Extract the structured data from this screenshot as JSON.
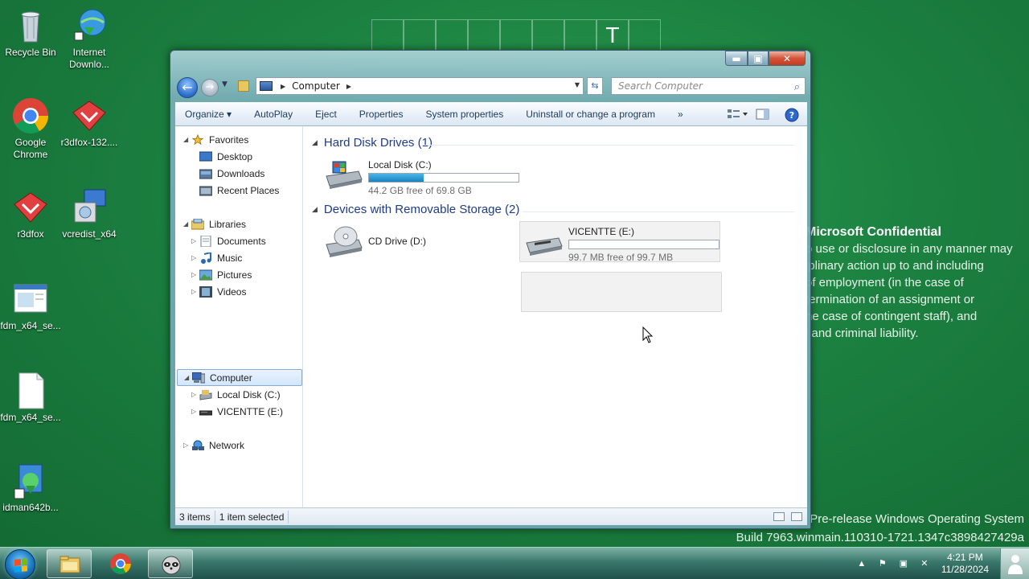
{
  "desktop": {
    "grid_letter": "T",
    "icons": [
      {
        "label": "Recycle Bin"
      },
      {
        "label": "Internet Downlo..."
      },
      {
        "label": "Google Chrome"
      },
      {
        "label": "r3dfox-132...."
      },
      {
        "label": "r3dfox"
      },
      {
        "label": "vcredist_x64"
      },
      {
        "label": "fdm_x64_se..."
      },
      {
        "label": "fdm_x64_se..."
      },
      {
        "label": "idman642b..."
      }
    ],
    "confidential": {
      "title": "Microsoft Confidential",
      "lines": [
        "o use or disclosure in any manner may",
        "iplinary action up to and including",
        "of employment (in the case of",
        "termination of an assignment or",
        "he case of contingent staff), and",
        "l and criminal liability."
      ]
    },
    "watermark": {
      "line1": "Pre-release Windows Operating System",
      "line2": "Build 7963.winmain.110310-1721.1347c3898427429a"
    }
  },
  "window": {
    "caption_buttons": {
      "minimize": "▬",
      "maximize": "▣",
      "close": "✕"
    },
    "address": {
      "crumb": "Computer"
    },
    "search": {
      "placeholder": "Search Computer"
    },
    "toolbar": {
      "organize": "Organize ▾",
      "autoplay": "AutoPlay",
      "eject": "Eject",
      "properties": "Properties",
      "system_properties": "System properties",
      "uninstall": "Uninstall or change a program",
      "more": "»"
    },
    "nav": {
      "favorites": "Favorites",
      "desktop": "Desktop",
      "downloads": "Downloads",
      "recent": "Recent Places",
      "libraries": "Libraries",
      "documents": "Documents",
      "music": "Music",
      "pictures": "Pictures",
      "videos": "Videos",
      "computer": "Computer",
      "local_disk": "Local Disk (C:)",
      "vicentte": "VICENTTE (E:)",
      "network": "Network"
    },
    "groups": {
      "hdd": "Hard Disk Drives (1)",
      "removable": "Devices with Removable Storage (2)"
    },
    "drives": [
      {
        "name": "Local Disk (C:)",
        "free": "44.2 GB free of 69.8 GB",
        "used_fraction": 0.367
      },
      {
        "name": "CD Drive (D:)"
      },
      {
        "name": "VICENTTE (E:)",
        "free": "99.7 MB free of 99.7 MB",
        "used_fraction": 0.0
      }
    ],
    "status": {
      "items": "3 items",
      "selected": "1 item selected"
    }
  },
  "taskbar": {
    "clock_time": "4:21 PM",
    "clock_date": "11/28/2024"
  },
  "colors": {
    "desktop_green": "#1b8040",
    "drive_bar": "#1c80c0",
    "group_header": "#1e3c8c"
  }
}
